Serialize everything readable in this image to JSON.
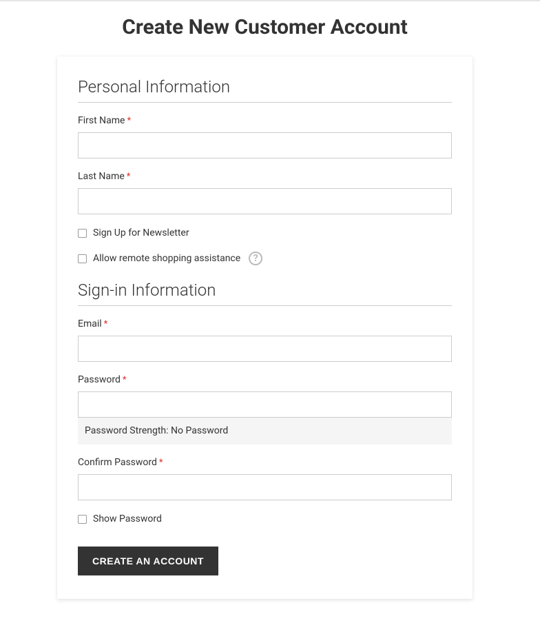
{
  "page": {
    "title": "Create New Customer Account"
  },
  "personal": {
    "legend": "Personal Information",
    "firstName": {
      "label": "First Name",
      "value": ""
    },
    "lastName": {
      "label": "Last Name",
      "value": ""
    },
    "newsletter": {
      "label": "Sign Up for Newsletter",
      "checked": false
    },
    "remoteAssist": {
      "label": "Allow remote shopping assistance",
      "checked": false
    }
  },
  "signin": {
    "legend": "Sign-in Information",
    "email": {
      "label": "Email",
      "value": ""
    },
    "password": {
      "label": "Password",
      "value": ""
    },
    "passwordStrength": {
      "prefix": "Password Strength: ",
      "value": "No Password"
    },
    "confirmPassword": {
      "label": "Confirm Password",
      "value": ""
    },
    "showPassword": {
      "label": "Show Password",
      "checked": false
    }
  },
  "submit": {
    "label": "CREATE AN ACCOUNT"
  },
  "glyphs": {
    "required": "*",
    "help": "?"
  }
}
